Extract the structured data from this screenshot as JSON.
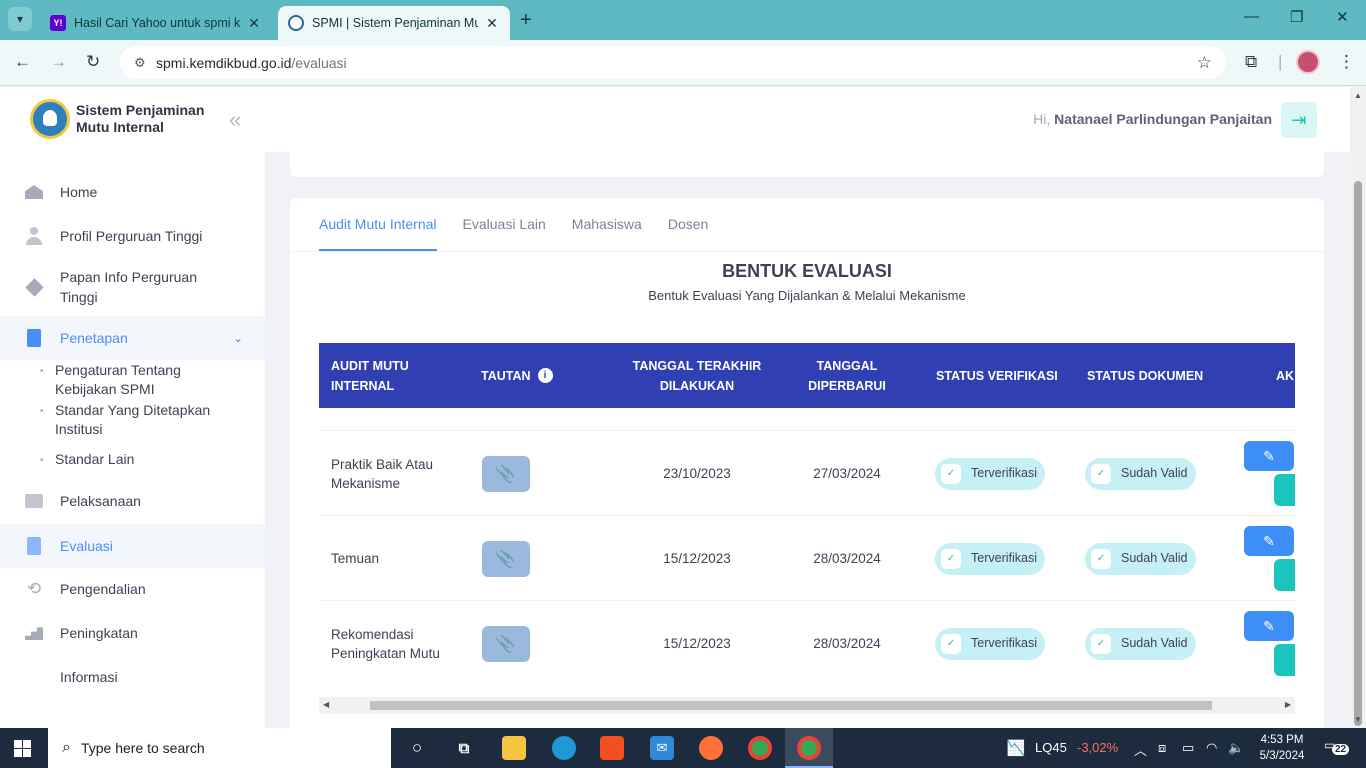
{
  "browser": {
    "tabs": [
      {
        "title": "Hasil Cari Yahoo untuk spmi kem",
        "favicon": "yahoo-icon",
        "active": false
      },
      {
        "title": "SPMI | Sistem Penjaminan Mutu",
        "favicon": "kemdikbud-icon",
        "active": true
      }
    ],
    "url_host": "spmi.kemdikbud.go.id",
    "url_path": "/evaluasi"
  },
  "sidebar": {
    "brand": {
      "line1": "Sistem Penjaminan",
      "line2": "Mutu Internal"
    },
    "items": [
      {
        "label": "Home",
        "icon": "home-icon"
      },
      {
        "label": "Profil Perguruan Tinggi",
        "icon": "user-icon"
      },
      {
        "label": "Papan Info Perguruan Tinggi",
        "icon": "layers-icon"
      },
      {
        "label": "Penetapan",
        "icon": "building-icon"
      },
      {
        "label": "Pelaksanaan",
        "icon": "book-icon"
      },
      {
        "label": "Evaluasi",
        "icon": "clipboard-icon"
      },
      {
        "label": "Pengendalian",
        "icon": "loop-icon"
      },
      {
        "label": "Peningkatan",
        "icon": "stairs-icon"
      },
      {
        "label": "Informasi",
        "icon": ""
      }
    ],
    "sub_items": [
      "Pengaturan Tentang Kebijakan SPMI",
      "Standar Yang Ditetapkan Institusi",
      "Standar Lain"
    ]
  },
  "header": {
    "greeting_prefix": "Hi,",
    "user_name": "Natanael Parlindungan Panjaitan"
  },
  "tabs": [
    "Audit Mutu Internal",
    "Evaluasi Lain",
    "Mahasiswa",
    "Dosen"
  ],
  "section": {
    "title": "BENTUK EVALUASI",
    "subtitle": "Bentuk Evaluasi Yang Dijalankan & Melalui Mekanisme"
  },
  "table": {
    "columns": [
      "AUDIT MUTU INTERNAL",
      "TAUTAN",
      "TANGGAL TERAKHIR DILAKUKAN",
      "TANGGAL DIPERBARUI",
      "STATUS VERIFIKASI",
      "STATUS DOKUMEN",
      "AKSI"
    ],
    "columns_visible": {
      "action": "AK"
    },
    "rows": [
      {
        "name": "Praktik Baik Atau Mekanisme",
        "last_done": "23/10/2023",
        "updated": "27/03/2024",
        "verification": "Terverifikasi",
        "document": "Sudah Valid"
      },
      {
        "name": "Temuan",
        "last_done": "15/12/2023",
        "updated": "28/03/2024",
        "verification": "Terverifikasi",
        "document": "Sudah Valid"
      },
      {
        "name": "Rekomendasi Peningkatan Mutu",
        "last_done": "15/12/2023",
        "updated": "28/03/2024",
        "verification": "Terverifikasi",
        "document": "Sudah Valid"
      }
    ]
  },
  "taskbar": {
    "search_placeholder": "Type here to search",
    "stock_name": "LQ45",
    "stock_change": "-3,02%",
    "time": "4:53 PM",
    "date": "5/3/2024",
    "notifications": "22"
  },
  "colors": {
    "primary": "#4a8ff7",
    "table_header": "#3040b3",
    "success_pill": "#c4f0f6",
    "teal": "#1bc5bd",
    "stock_negative": "#ff6b6b"
  }
}
